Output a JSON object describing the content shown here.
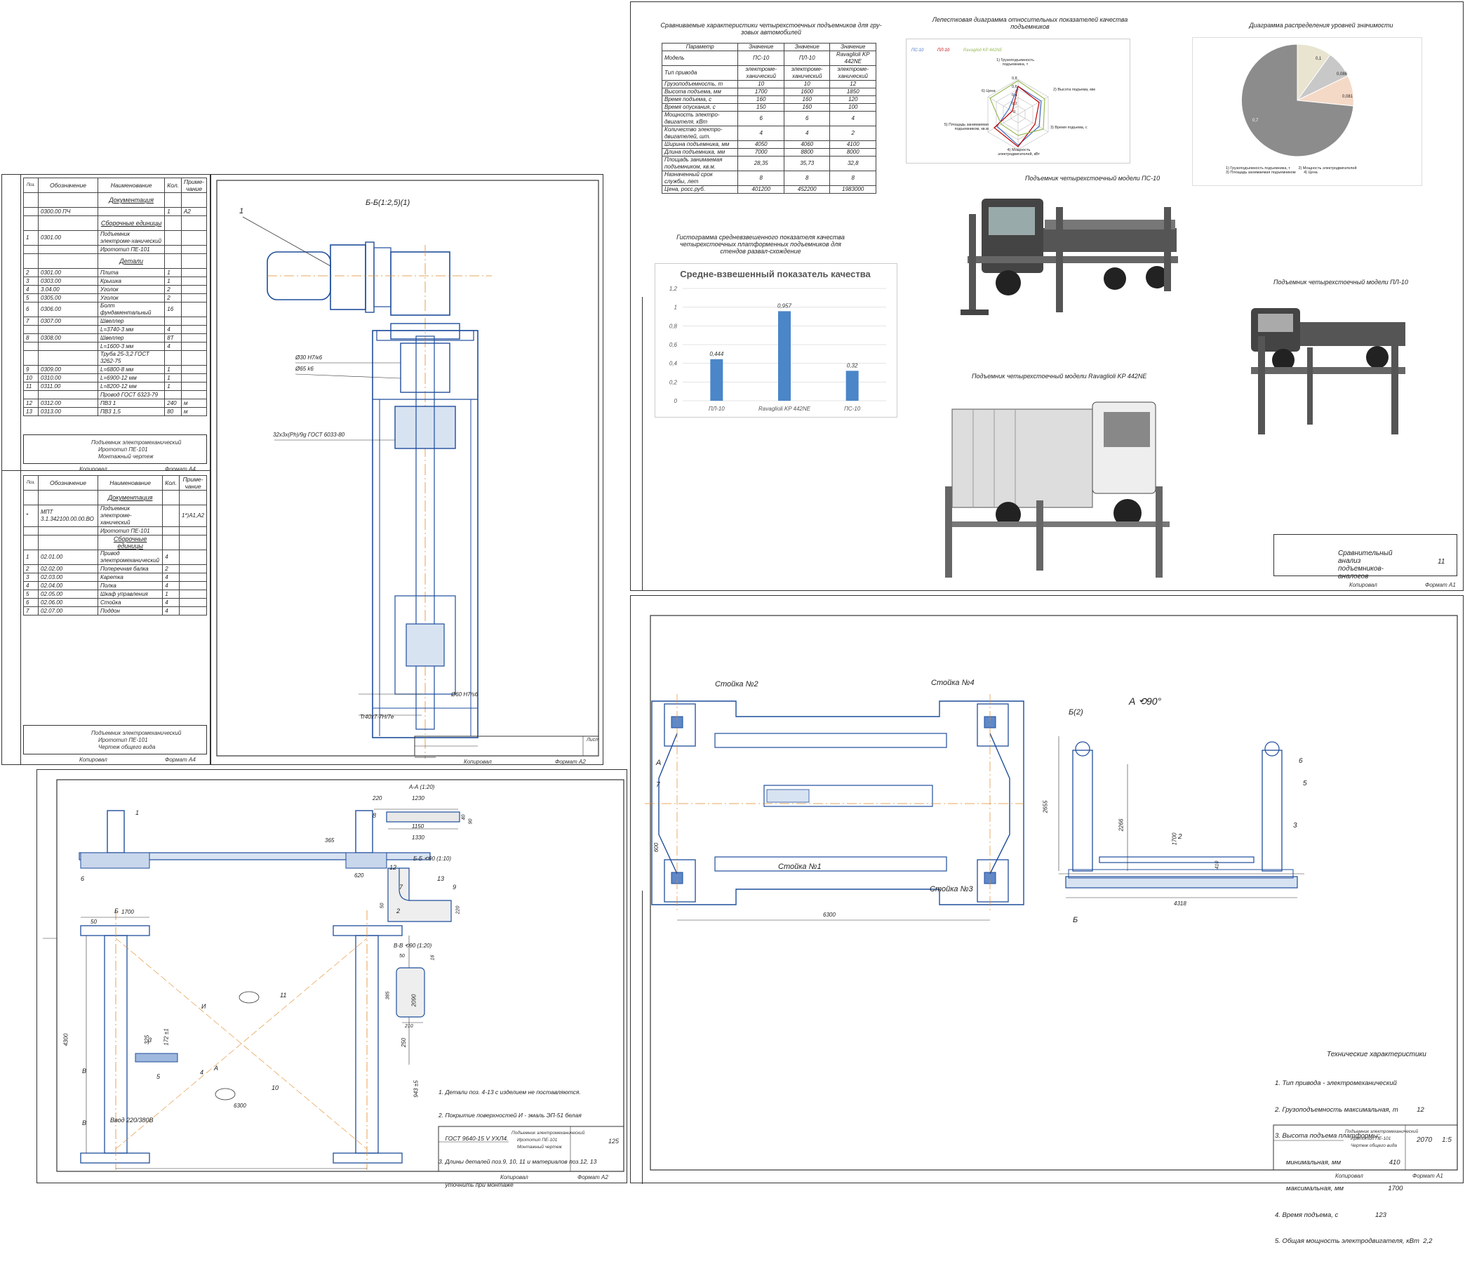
{
  "spec1": {
    "headers": [
      "Поз.",
      "Обозначение",
      "Наименование",
      "Кол.",
      "Приме-чание"
    ],
    "rows": [
      {
        "pos": "",
        "des": "",
        "name": "Документация",
        "qty": "",
        "note": "",
        "section": true
      },
      {
        "pos": "",
        "des": "0300.00 ПЧ",
        "name": "",
        "qty": "1",
        "note": "А2"
      },
      {
        "pos": "",
        "des": "",
        "name": "Сборочные единицы",
        "qty": "",
        "note": "",
        "section": true
      },
      {
        "pos": "1",
        "des": "0301.00",
        "name": "Подъемник электроме-ханический",
        "qty": "",
        "note": ""
      },
      {
        "pos": "",
        "des": "",
        "name": "Ирототип ПЕ-101",
        "qty": "",
        "note": ""
      },
      {
        "pos": "",
        "des": "",
        "name": "Детали",
        "qty": "",
        "note": "",
        "section": true
      },
      {
        "pos": "2",
        "des": "0301.00",
        "name": "Плита",
        "qty": "1",
        "note": ""
      },
      {
        "pos": "3",
        "des": "0303.00",
        "name": "Крышка",
        "qty": "1",
        "note": ""
      },
      {
        "pos": "4",
        "des": "3.04.00",
        "name": "Уголок",
        "qty": "2",
        "note": ""
      },
      {
        "pos": "5",
        "des": "0305.00",
        "name": "Уголок",
        "qty": "2",
        "note": ""
      },
      {
        "pos": "6",
        "des": "0306.00",
        "name": "Болт фундаментальный",
        "qty": "16",
        "note": ""
      },
      {
        "pos": "7",
        "des": "0307.00",
        "name": "Швеллер",
        "qty": "",
        "note": ""
      },
      {
        "pos": "",
        "des": "",
        "name": "L=3740-3 мм",
        "qty": "4",
        "note": ""
      },
      {
        "pos": "8",
        "des": "0308.00",
        "name": "Швеллер",
        "qty": "8Т",
        "note": ""
      },
      {
        "pos": "",
        "des": "",
        "name": "L=1600-3 мм",
        "qty": "4",
        "note": ""
      },
      {
        "pos": "",
        "des": "",
        "name": "Труба 25-3,2 ГОСТ 3262-75",
        "qty": "",
        "note": ""
      },
      {
        "pos": "9",
        "des": "0309.00",
        "name": "L=6800-8 мм",
        "qty": "1",
        "note": ""
      },
      {
        "pos": "10",
        "des": "0310.00",
        "name": "L=6900-12 мм",
        "qty": "1",
        "note": ""
      },
      {
        "pos": "11",
        "des": "0311.00",
        "name": "L=8200-12 мм",
        "qty": "1",
        "note": ""
      },
      {
        "pos": "",
        "des": "",
        "name": "Провод ГОСТ 6323-79",
        "qty": "",
        "note": ""
      },
      {
        "pos": "12",
        "des": "0312.00",
        "name": "ПВ3 1",
        "qty": "240",
        "note": "м"
      },
      {
        "pos": "13",
        "des": "0313.00",
        "name": "ПВ3 1,5",
        "qty": "80",
        "note": "м"
      }
    ],
    "title_line1": "Подъемник электромеханический",
    "title_line2": "Ирототип ПЕ-101",
    "title_line3": "Монтажный чертеж",
    "copied": "Копировал",
    "format": "Формат А4"
  },
  "spec2": {
    "headers": [
      "Поз.",
      "Обозначение",
      "Наименование",
      "Кол.",
      "Приме-чание"
    ],
    "rows": [
      {
        "pos": "",
        "des": "",
        "name": "Документация",
        "qty": "",
        "note": "",
        "section": true
      },
      {
        "pos": "*",
        "des": "МПТ 3.1.342100.00.00.ВО",
        "name": "Подъемник электроме-ханический",
        "qty": "",
        "note": "1*)А1,А2"
      },
      {
        "pos": "",
        "des": "",
        "name": "Ирототип ПЕ-101",
        "qty": "",
        "note": ""
      },
      {
        "pos": "",
        "des": "",
        "name": "Сборочные единицы",
        "qty": "",
        "note": "",
        "section": true
      },
      {
        "pos": "1",
        "des": "02.01.00",
        "name": "Привод электромеханический",
        "qty": "4",
        "note": ""
      },
      {
        "pos": "2",
        "des": "02.02.00",
        "name": "Поперечная балка",
        "qty": "2",
        "note": ""
      },
      {
        "pos": "3",
        "des": "02.03.00",
        "name": "Каретка",
        "qty": "4",
        "note": ""
      },
      {
        "pos": "4",
        "des": "02.04.00",
        "name": "Полка",
        "qty": "4",
        "note": ""
      },
      {
        "pos": "5",
        "des": "02.05.00",
        "name": "Шкаф управления",
        "qty": "1",
        "note": ""
      },
      {
        "pos": "6",
        "des": "02.06.00",
        "name": "Стойка",
        "qty": "4",
        "note": ""
      },
      {
        "pos": "7",
        "des": "02.07.00",
        "name": "Поддон",
        "qty": "4",
        "note": ""
      }
    ],
    "title_line1": "Подъемник электромеханический",
    "title_line2": "Ирототип ПЕ-101",
    "title_line3": "Чертеж общего вида",
    "copied": "Копировал",
    "format": "Формат А4"
  },
  "drive_sheet": {
    "section_label": "Б-Б(1:2,5)(1)",
    "callout": "1",
    "dim1": "Ø30 Н7/к6",
    "dim2": "Ø65 k6",
    "thread": "32х3х(Рh)/9g ГОСТ 6033-80",
    "dim3": "Ø60 Н7/s6",
    "dim4": "Tr40х7-7H/7e",
    "copied": "Копировал",
    "format": "Формат А2",
    "sheet_label": "Лист"
  },
  "compare_sheet": {
    "table_title": "Сравниваемые характеристики четырехстоечных подъемников для гру-зовых автомобилей",
    "table_headers": [
      "Параметр",
      "Значение",
      "Значение",
      "Значение"
    ],
    "table_rows": [
      [
        "Модель",
        "ПС-10",
        "ПЛ-10",
        "Ravaglioli KP 442NE"
      ],
      [
        "Тип привода",
        "электроме-ханический",
        "электроме-ханический",
        "электроме-ханический"
      ],
      [
        "Грузоподъемность, т",
        "10",
        "10",
        "12"
      ],
      [
        "Высота подъема, мм",
        "1700",
        "1600",
        "1850"
      ],
      [
        "Время подъема, с",
        "160",
        "160",
        "120"
      ],
      [
        "Время опускания, с",
        "150",
        "160",
        "100"
      ],
      [
        "Мощность электро-двигателя, кВт",
        "6",
        "6",
        "4"
      ],
      [
        "Количество электро-двигателей, шт.",
        "4",
        "4",
        "2"
      ],
      [
        "Ширина подъемника, мм",
        "4050",
        "4060",
        "4100"
      ],
      [
        "Длина подъемника, мм",
        "7000",
        "8800",
        "8000"
      ],
      [
        "Площадь занимаемая подъемником, кв.м.",
        "28,35",
        "35,73",
        "32,8"
      ],
      [
        "Назначенный срок службы, лет",
        "8",
        "8",
        "8"
      ],
      [
        "Цена, росс.руб.",
        "401200",
        "452200",
        "1983000"
      ]
    ],
    "radar_title": "Лепестковая диаграмма относительных показателей качества подъемников",
    "radar_legend": [
      "ПС-10",
      "ПЛ-10",
      "Ravaglioli KP 442NE"
    ],
    "radar_axes": [
      "1) Грузоподъемность подъемника, т",
      "2) Высота подъема, мм",
      "3) Время подъема, с",
      "4) Мощность электродвигателей, кВт",
      "5) Площадь занимаемая подъемником, кв.м",
      "6) Цена"
    ],
    "radar_ticks": [
      "0,8",
      "0,6",
      "0,4",
      "0,2",
      "0"
    ],
    "pie_title": "Диаграмма распределения уровней значимости",
    "pie_labels": [
      "0,1",
      "0,086",
      "0,081",
      "0,7"
    ],
    "pie_legend": [
      "1) Грузоподъемность подъемника, т",
      "2) Мощность электродвигателей",
      "3) Площадь занимаемая подъемником",
      "4) Цена"
    ],
    "hist_title": "Гистограмма средневзвешенного показателя качества четырехстоечных платформенных подъемников для стендов развал-схождение",
    "photo1_caption": "Подъемник четырехстоечный модели ПС-10",
    "photo2_caption": "Подъемник четырехстоечный модели ПЛ-10",
    "photo3_caption": "Подъемник четырехстоечный модели Ravaglioli KP 442NE",
    "title": "Сравнительный анализ подъемников-аналогов",
    "sheet_no": "11",
    "copied": "Копировал",
    "format": "Формат А1"
  },
  "chart_data": {
    "type": "bar",
    "title": "Средне-взвешенный показатель качества",
    "categories": [
      "ПЛ-10",
      "Ravaglioli KP 442NE",
      "ПС-10"
    ],
    "values": [
      0.444,
      0.957,
      0.32
    ],
    "value_labels": [
      "0,444",
      "0,957",
      "0,32"
    ],
    "yticks": [
      "0",
      "0,2",
      "0,4",
      "0,6",
      "0,8",
      "1",
      "1,2"
    ],
    "ylim": [
      0,
      1.2
    ],
    "xlabel": "",
    "ylabel": "",
    "bar_color": "#4a86c8"
  },
  "install_sheet": {
    "labels": {
      "p1": "1",
      "p2": "2",
      "p3": "3",
      "p4": "4",
      "p5": "5",
      "p6": "6",
      "p7": "7",
      "p8": "8",
      "p9": "9",
      "p10": "10",
      "p11": "11",
      "p12": "12",
      "p13": "13",
      "I": "И",
      "A": "А",
      "B": "Б",
      "V": "В",
      "N1": "N₁"
    },
    "dims": {
      "d365": "365",
      "d620": "620",
      "d1700": "1700",
      "d50": "50",
      "d4300": "4300",
      "d2090": "2090",
      "d325": "325",
      "d172": "172 ±1",
      "d250": "250",
      "d943": "943 ±5",
      "d6300": "6300",
      "d220": "220",
      "d1230": "1230",
      "d1150": "1150",
      "d1330": "1330",
      "d40": "40",
      "d90": "90",
      "d50b": "50",
      "d220b": "220",
      "d385": "385",
      "d16": "16",
      "d210": "210"
    },
    "sectAA": "А-А (1:20)",
    "sectBB": "Б-Б ⟲90 (1:10)",
    "sectVV": "В-В ⟲90 (1:20)",
    "power": "Ввод 220/380В",
    "notes": [
      "1. Детали поз. 4-13 с изделием не поставляются.",
      "2. Покрытие поверхностей И - эмаль ЭП-51 белая",
      "    ГОСТ 9640-15 V УХЛ4.",
      "3. Длины деталей поз.9, 10, 11 и материалов поз.12, 13",
      "    уточнить при монтаже"
    ],
    "title_line1": "Подъемник электромеханический",
    "title_line2": "Ирототип ПЕ-101",
    "title_line3": "Монтажный чертеж",
    "mass": "125",
    "copied": "Копировал",
    "format": "Формат А2"
  },
  "assembly_sheet": {
    "stands": [
      "Стойка №2",
      "Стойка №4",
      "Стойка №1",
      "Стойка №3"
    ],
    "view": "А ⟲90°",
    "cut": "Б(2)",
    "cutB": "Б",
    "A": "А",
    "p7": "7",
    "p2": "2",
    "p3": "3",
    "p5": "5",
    "p6": "6",
    "dims": {
      "d600": "600",
      "d6300": "6300",
      "d4318": "4318",
      "d2655": "2655",
      "d2266": "2266",
      "d1700": "1700",
      "d410": "410"
    },
    "tech_title": "Технические характеристики",
    "tech_lines": [
      "1. Тип привода - электромеханический",
      "2. Грузоподъемность максимальная, т          12",
      "3. Высота подъема платформы:",
      "      минимальная, мм                          410",
      "      максимальная, мм                        1700",
      "4. Время подъема, с                    123",
      "5. Общая мощность электродвигателя, кВт  2,2"
    ],
    "title_line1": "Подъемник электромеханический",
    "title_line2": "Ирототип ПЕ-101",
    "title_line3": "Чертеж общего вида",
    "mass": "2070",
    "scale": "1:5",
    "copied": "Копировал",
    "format": "Формат А1"
  }
}
